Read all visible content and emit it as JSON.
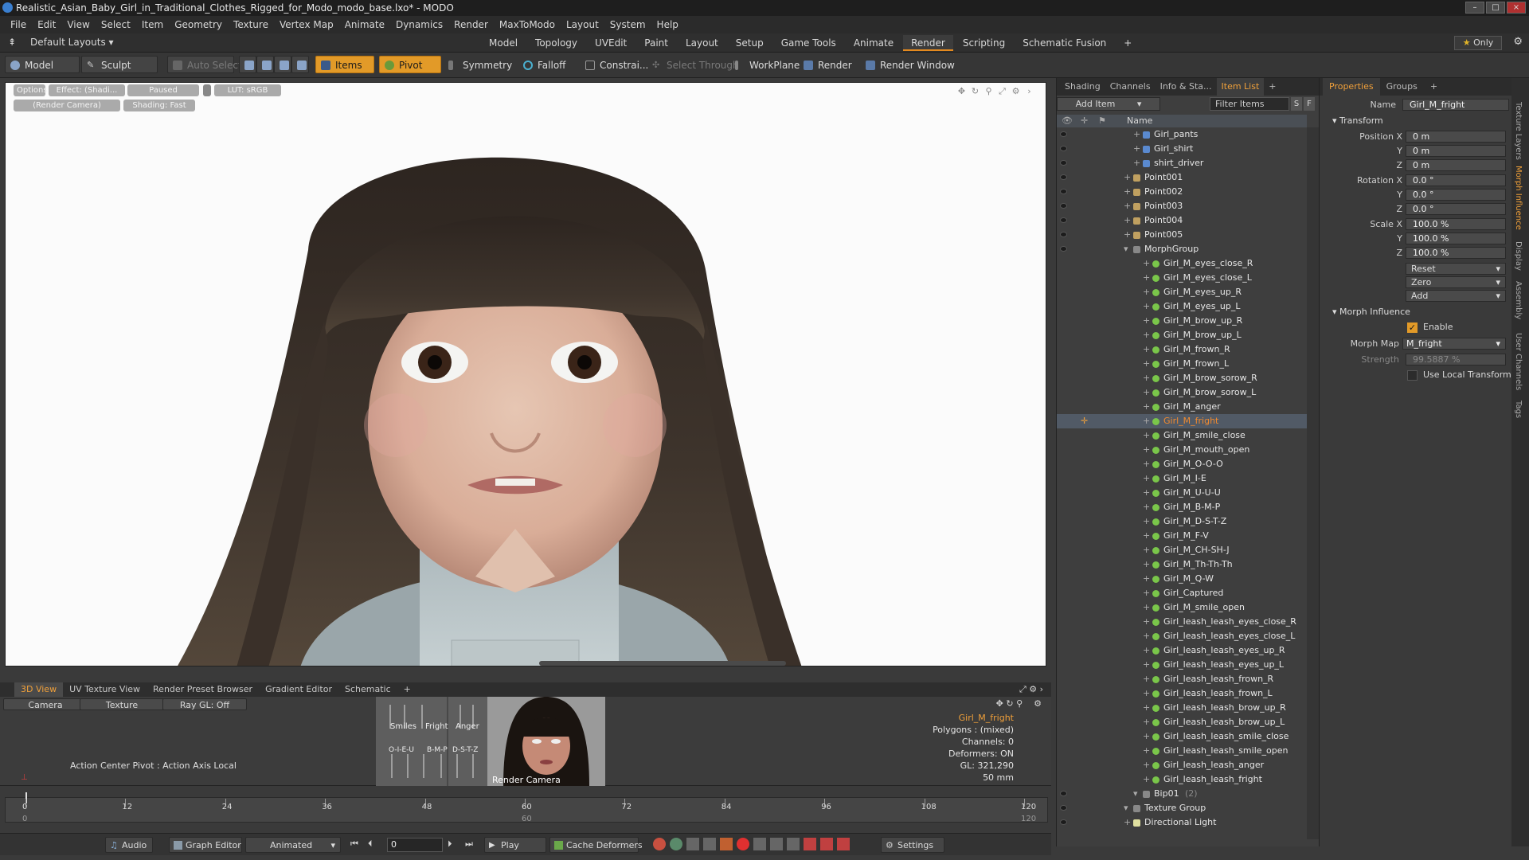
{
  "window": {
    "title": "Realistic_Asian_Baby_Girl_in_Traditional_Clothes_Rigged_for_Modo_modo_base.lxo* - MODO"
  },
  "menu": [
    "File",
    "Edit",
    "View",
    "Select",
    "Item",
    "Geometry",
    "Texture",
    "Vertex Map",
    "Animate",
    "Dynamics",
    "Render",
    "MaxToModo",
    "Layout",
    "System",
    "Help"
  ],
  "layout": {
    "preset": "Default Layouts",
    "tabs": [
      "Model",
      "Topology",
      "UVEdit",
      "Paint",
      "Layout",
      "Setup",
      "Game Tools",
      "Animate",
      "Render",
      "Scripting",
      "Schematic Fusion"
    ],
    "active_tab": "Render",
    "only_label": "Only"
  },
  "toolbar": {
    "model": "Model",
    "sculpt": "Sculpt",
    "auto_select": "Auto Select",
    "items": "Items",
    "pivot": "Pivot",
    "symmetry": "Symmetry",
    "falloff": "Falloff",
    "constraints": "Constrai...",
    "select_through": "Select Through",
    "workplane": "WorkPlane",
    "render": "Render",
    "render_window": "Render Window"
  },
  "viewport": {
    "options": "Options",
    "effect": "Effect: (Shadi...",
    "paused": "Paused",
    "lut": "LUT: sRGB",
    "camera": "(Render Camera)",
    "shading": "Shading: Fast",
    "icons": [
      "move-view-icon",
      "rotate-view-icon",
      "zoom-view-icon",
      "fit-view-icon",
      "settings-icon",
      "expand-icon"
    ]
  },
  "bottom_tabs": [
    "3D View",
    "UV Texture View",
    "Render Preset Browser",
    "Gradient Editor",
    "Schematic"
  ],
  "lower": {
    "camera": "Camera",
    "texture": "Texture",
    "raygl": "Ray GL: Off",
    "action_center": "Action Center Pivot : Action Axis Local",
    "render_camera": "Render Camera",
    "slider_labels": [
      "Smiles",
      "Fright",
      "Anger",
      "O-I-E-U",
      "B-M-P",
      "D-S-T-Z"
    ],
    "info": {
      "selected": "Girl_M_fright",
      "polygons": "Polygons : (mixed)",
      "channels": "Channels: 0",
      "deformers": "Deformers: ON",
      "gl": "GL: 321,290",
      "dist": "50 mm"
    }
  },
  "timeline": {
    "top_ticks": [
      "0",
      "12",
      "24",
      "36",
      "48",
      "60",
      "72",
      "84",
      "96",
      "108",
      "120"
    ],
    "bottom_ticks": [
      "0",
      "60",
      "120"
    ]
  },
  "transport": {
    "audio": "Audio",
    "graph_editor": "Graph Editor",
    "mode": "Animated",
    "frame": "0",
    "play": "Play",
    "cache": "Cache Deformers",
    "settings": "Settings"
  },
  "itemlist": {
    "tabs": [
      "Shading",
      "Channels",
      "Info & Sta...",
      "Item List"
    ],
    "active_tab": "Item List",
    "add_item": "Add Item",
    "filter": "Filter Items",
    "s_btn": "S",
    "f_btn": "F",
    "header": "Name",
    "rows": [
      {
        "name": "Girl_pants",
        "indent": 2,
        "type": "mesh",
        "eye": true
      },
      {
        "name": "Girl_shirt",
        "indent": 2,
        "type": "mesh",
        "eye": true
      },
      {
        "name": "shirt_driver",
        "indent": 2,
        "type": "mesh",
        "eye": true
      },
      {
        "name": "Point001",
        "indent": 1,
        "type": "locator",
        "eye": true
      },
      {
        "name": "Point002",
        "indent": 1,
        "type": "locator",
        "eye": true
      },
      {
        "name": "Point003",
        "indent": 1,
        "type": "locator",
        "eye": true
      },
      {
        "name": "Point004",
        "indent": 1,
        "type": "locator",
        "eye": true
      },
      {
        "name": "Point005",
        "indent": 1,
        "type": "locator",
        "eye": true
      },
      {
        "name": "MorphGroup",
        "indent": 1,
        "type": "group",
        "eye": true
      },
      {
        "name": "Girl_M_eyes_close_R",
        "indent": 3,
        "type": "morph"
      },
      {
        "name": "Girl_M_eyes_close_L",
        "indent": 3,
        "type": "morph"
      },
      {
        "name": "Girl_M_eyes_up_R",
        "indent": 3,
        "type": "morph"
      },
      {
        "name": "Girl_M_eyes_up_L",
        "indent": 3,
        "type": "morph"
      },
      {
        "name": "Girl_M_brow_up_R",
        "indent": 3,
        "type": "morph"
      },
      {
        "name": "Girl_M_brow_up_L",
        "indent": 3,
        "type": "morph"
      },
      {
        "name": "Girl_M_frown_R",
        "indent": 3,
        "type": "morph"
      },
      {
        "name": "Girl_M_frown_L",
        "indent": 3,
        "type": "morph"
      },
      {
        "name": "Girl_M_brow_sorow_R",
        "indent": 3,
        "type": "morph"
      },
      {
        "name": "Girl_M_brow_sorow_L",
        "indent": 3,
        "type": "morph"
      },
      {
        "name": "Girl_M_anger",
        "indent": 3,
        "type": "morph"
      },
      {
        "name": "Girl_M_fright",
        "indent": 3,
        "type": "morph",
        "selected": true
      },
      {
        "name": "Girl_M_smile_close",
        "indent": 3,
        "type": "morph"
      },
      {
        "name": "Girl_M_mouth_open",
        "indent": 3,
        "type": "morph"
      },
      {
        "name": "Girl_M_O-O-O",
        "indent": 3,
        "type": "morph"
      },
      {
        "name": "Girl_M_I-E",
        "indent": 3,
        "type": "morph"
      },
      {
        "name": "Girl_M_U-U-U",
        "indent": 3,
        "type": "morph"
      },
      {
        "name": "Girl_M_B-M-P",
        "indent": 3,
        "type": "morph"
      },
      {
        "name": "Girl_M_D-S-T-Z",
        "indent": 3,
        "type": "morph"
      },
      {
        "name": "Girl_M_F-V",
        "indent": 3,
        "type": "morph"
      },
      {
        "name": "Girl_M_CH-SH-J",
        "indent": 3,
        "type": "morph"
      },
      {
        "name": "Girl_M_Th-Th-Th",
        "indent": 3,
        "type": "morph"
      },
      {
        "name": "Girl_M_Q-W",
        "indent": 3,
        "type": "morph"
      },
      {
        "name": "Girl_Captured",
        "indent": 3,
        "type": "morph"
      },
      {
        "name": "Girl_M_smile_open",
        "indent": 3,
        "type": "morph"
      },
      {
        "name": "Girl_leash_leash_eyes_close_R",
        "indent": 3,
        "type": "morph"
      },
      {
        "name": "Girl_leash_leash_eyes_close_L",
        "indent": 3,
        "type": "morph"
      },
      {
        "name": "Girl_leash_leash_eyes_up_R",
        "indent": 3,
        "type": "morph"
      },
      {
        "name": "Girl_leash_leash_eyes_up_L",
        "indent": 3,
        "type": "morph"
      },
      {
        "name": "Girl_leash_leash_frown_R",
        "indent": 3,
        "type": "morph"
      },
      {
        "name": "Girl_leash_leash_frown_L",
        "indent": 3,
        "type": "morph"
      },
      {
        "name": "Girl_leash_leash_brow_up_R",
        "indent": 3,
        "type": "morph"
      },
      {
        "name": "Girl_leash_leash_brow_up_L",
        "indent": 3,
        "type": "morph"
      },
      {
        "name": "Girl_leash_leash_smile_close",
        "indent": 3,
        "type": "morph"
      },
      {
        "name": "Girl_leash_leash_smile_open",
        "indent": 3,
        "type": "morph"
      },
      {
        "name": "Girl_leash_leash_anger",
        "indent": 3,
        "type": "morph"
      },
      {
        "name": "Girl_leash_leash_fright",
        "indent": 3,
        "type": "morph"
      },
      {
        "name": "Bip01",
        "indent": 2,
        "type": "group",
        "eye": true,
        "badge": "(2)"
      },
      {
        "name": "Texture Group",
        "indent": 1,
        "type": "group",
        "eye": true
      },
      {
        "name": "Directional Light",
        "indent": 1,
        "type": "light",
        "eye": true
      }
    ]
  },
  "properties": {
    "tabs": [
      "Properties",
      "Groups"
    ],
    "name_label": "Name",
    "name_value": "Girl_M_fright",
    "transform_label": "Transform",
    "position_label": "Position X",
    "pos": [
      "0 m",
      "0 m",
      "0 m"
    ],
    "rotation_label": "Rotation X",
    "rot": [
      "0.0 °",
      "0.0 °",
      "0.0 °"
    ],
    "scale_label": "Scale X",
    "scl": [
      "100.0 %",
      "100.0 %",
      "100.0 %"
    ],
    "y": "Y",
    "z": "Z",
    "reset": "Reset",
    "zero": "Zero",
    "add": "Add",
    "morph_influence": "Morph Influence",
    "enable": "Enable",
    "morph_map_label": "Morph Map",
    "morph_map": "M_fright",
    "strength_label": "Strength",
    "strength": "99.5887 %",
    "use_local": "Use Local Transform"
  },
  "side_tabs": [
    "Texture Layers",
    "Morph Influence",
    "Display",
    "Assembly",
    "User Channels",
    "Tags"
  ],
  "colors": {
    "accent": "#e29a28",
    "selected_text": "#f08a30",
    "morph_icon": "#7ac64a"
  }
}
